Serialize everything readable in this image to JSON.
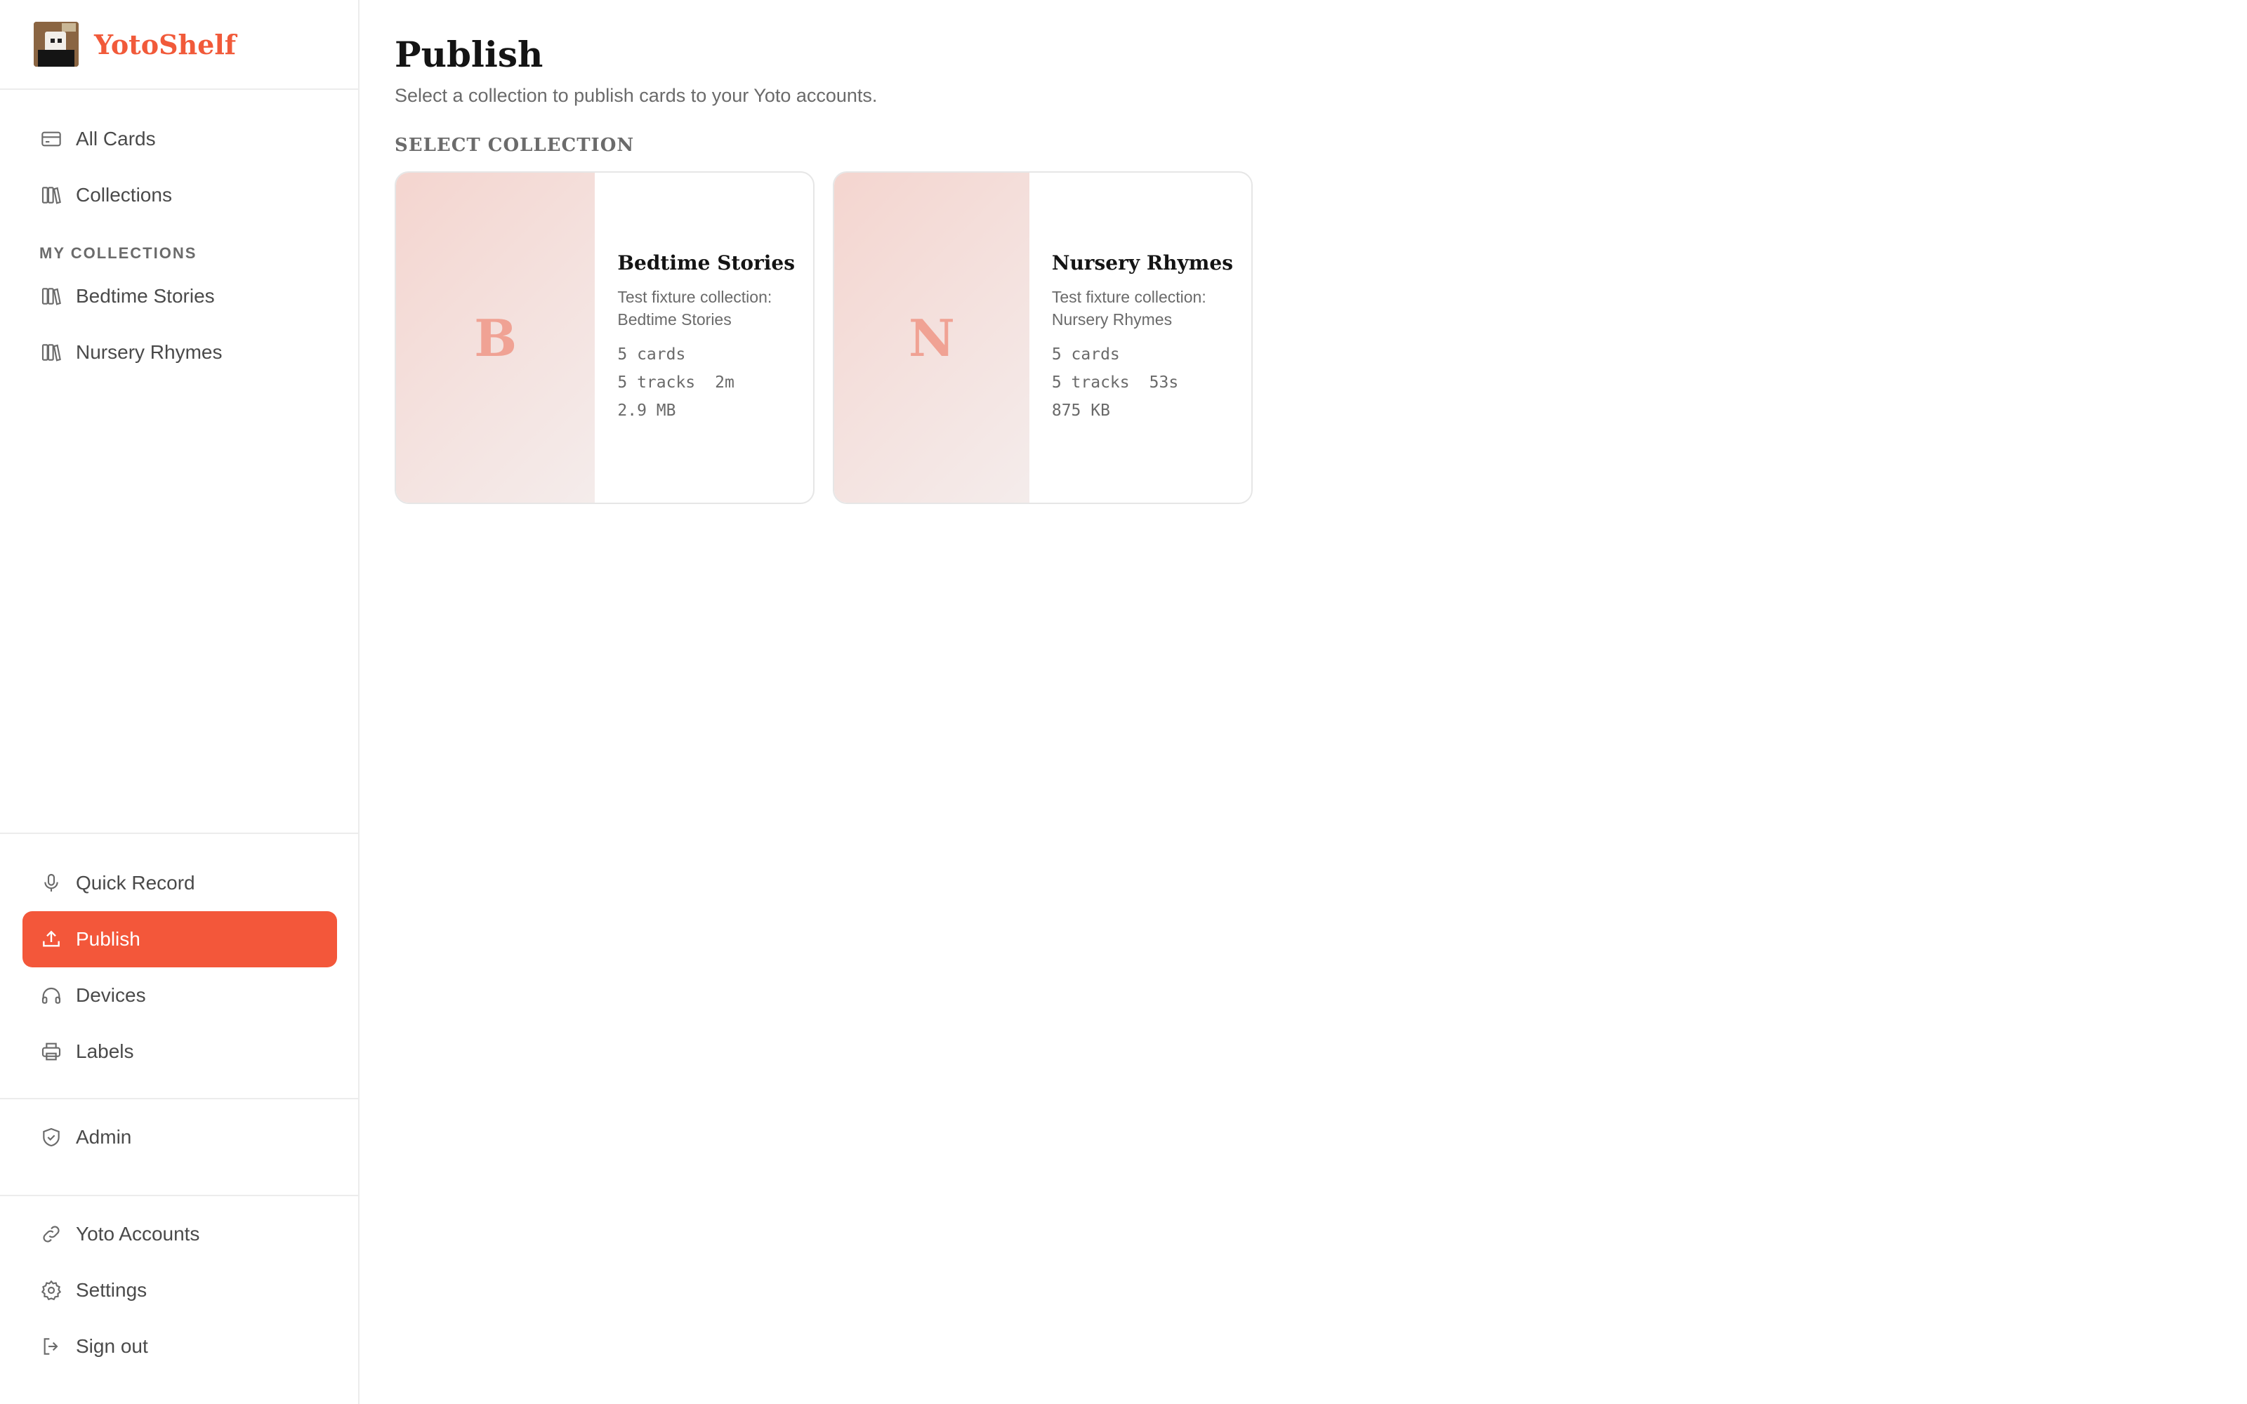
{
  "brand": {
    "name": "YotoShelf"
  },
  "sidebar": {
    "top_items": [
      {
        "label": "All Cards",
        "icon": "card-icon"
      },
      {
        "label": "Collections",
        "icon": "books-icon"
      }
    ],
    "section_label": "MY COLLECTIONS",
    "collections": [
      {
        "label": "Bedtime Stories",
        "icon": "books-icon"
      },
      {
        "label": "Nursery Rhymes",
        "icon": "books-icon"
      }
    ],
    "tools": [
      {
        "label": "Quick Record",
        "icon": "microphone-icon"
      },
      {
        "label": "Publish",
        "icon": "upload-icon",
        "active": true
      },
      {
        "label": "Devices",
        "icon": "headphones-icon"
      },
      {
        "label": "Labels",
        "icon": "printer-icon"
      }
    ],
    "admin": [
      {
        "label": "Admin",
        "icon": "shield-icon"
      }
    ],
    "account": [
      {
        "label": "Yoto Accounts",
        "icon": "link-icon"
      },
      {
        "label": "Settings",
        "icon": "gear-icon"
      },
      {
        "label": "Sign out",
        "icon": "sign-out-icon"
      }
    ]
  },
  "main": {
    "title": "Publish",
    "subtitle": "Select a collection to publish cards to your Yoto accounts.",
    "section_heading": "SELECT COLLECTION",
    "collections": [
      {
        "letter": "B",
        "title": "Bedtime Stories",
        "description": "Test fixture collection: Bedtime Stories",
        "cards": "5 cards",
        "tracks": "5 tracks",
        "duration": "2m",
        "size": "2.9 MB"
      },
      {
        "letter": "N",
        "title": "Nursery Rhymes",
        "description": "Test fixture collection: Nursery Rhymes",
        "cards": "5 cards",
        "tracks": "5 tracks",
        "duration": "53s",
        "size": "875 KB"
      }
    ]
  },
  "colors": {
    "accent": "#f3573a",
    "brand": "#f15a3a",
    "card_art": "#f4d5cf",
    "card_letter": "#f0a294"
  }
}
